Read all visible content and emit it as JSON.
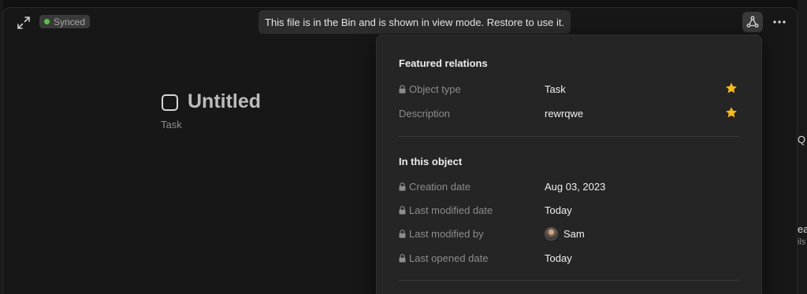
{
  "background": {
    "right_fragments": [
      "Q",
      "ea",
      "ils"
    ]
  },
  "toolbar": {
    "synced_label": "Synced",
    "bin_notice": "This file is in the Bin and is shown in view mode. Restore to use it.",
    "expand_icon": "expand-icon",
    "relations_icon": "relations-graph-icon",
    "more_icon": "more-dots-icon"
  },
  "object": {
    "title": "Untitled",
    "type": "Task"
  },
  "popup": {
    "featured": {
      "title": "Featured relations",
      "rows": [
        {
          "name": "Object type",
          "value": "Task",
          "locked": true,
          "featured": true
        },
        {
          "name": "Description",
          "value": "rewrqwe",
          "locked": false,
          "featured": true
        }
      ]
    },
    "in_object": {
      "title": "In this object",
      "rows": [
        {
          "name": "Creation date",
          "value": "Aug 03, 2023",
          "locked": true
        },
        {
          "name": "Last modified date",
          "value": "Today",
          "locked": true
        },
        {
          "name": "Last modified by",
          "value": "Sam",
          "locked": true,
          "avatar": true
        },
        {
          "name": "Last opened date",
          "value": "Today",
          "locked": true
        }
      ]
    }
  },
  "colors": {
    "synced_dot": "#57c443",
    "star": "#f5b921",
    "popup_bg": "#252525",
    "window_bg": "#171717"
  }
}
